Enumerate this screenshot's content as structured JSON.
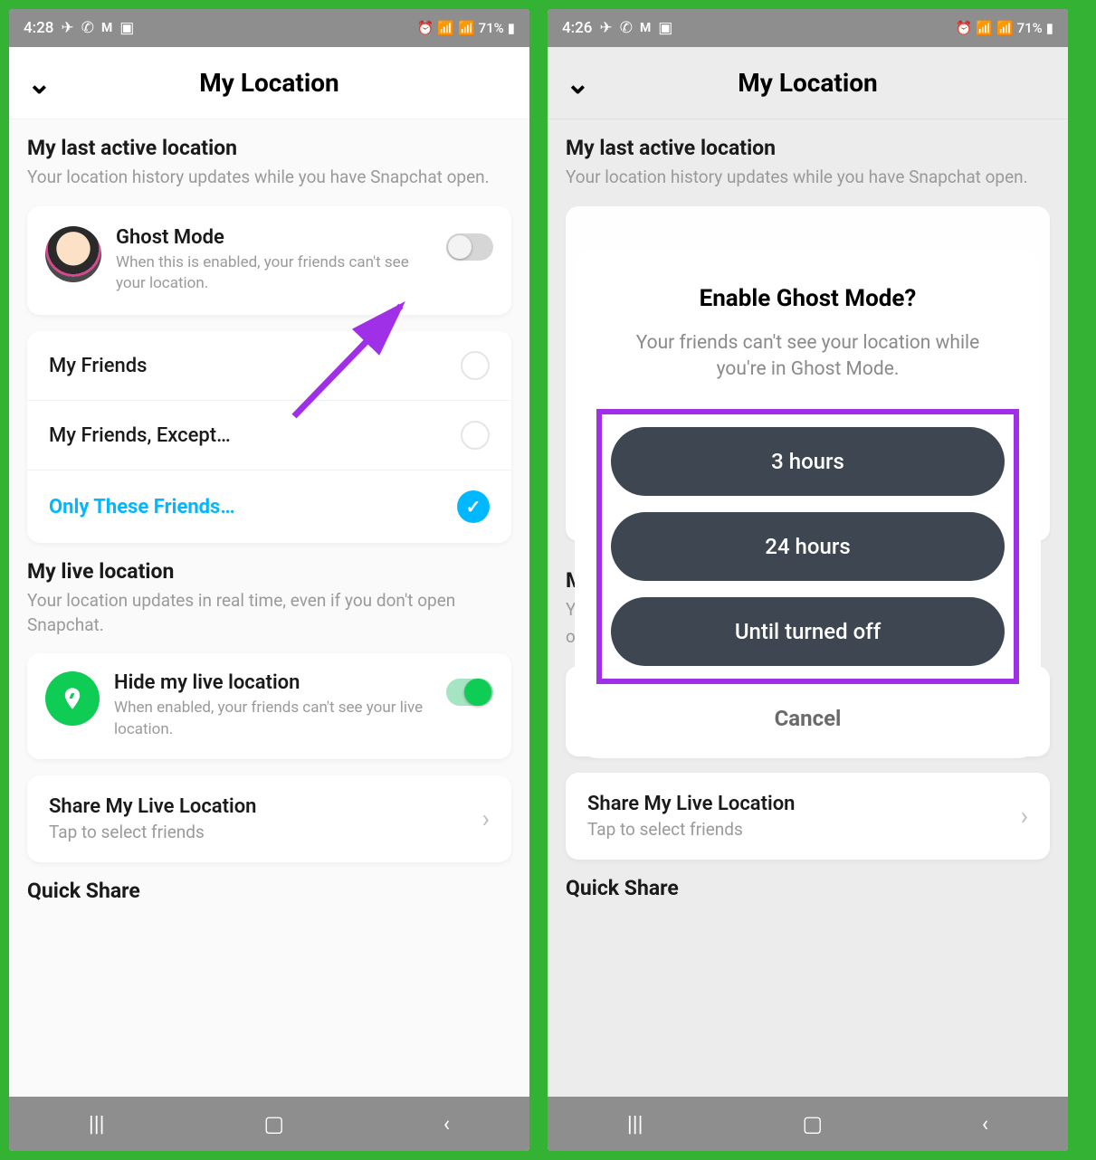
{
  "status": {
    "time_left": "4:28",
    "time_right": "4:26",
    "battery": "71%"
  },
  "header": {
    "title": "My Location"
  },
  "section1": {
    "title": "My last active location",
    "sub": "Your location history updates while you have Snapchat open."
  },
  "ghost": {
    "title": "Ghost Mode",
    "sub": "When this is enabled, your friends can't see your location."
  },
  "radios": {
    "opt1": "My Friends",
    "opt2": "My Friends, Except…",
    "opt3": "Only These Friends…"
  },
  "section2": {
    "title": "My live location",
    "sub": "Your location updates in real time, even if you don't open Snapchat."
  },
  "hide": {
    "title": "Hide my live location",
    "sub": "When enabled, your friends can't see your live location."
  },
  "share": {
    "title": "Share My Live Location",
    "sub": "Tap to select friends"
  },
  "cutoff": "Quick Share",
  "modal": {
    "title": "Enable Ghost Mode?",
    "sub": "Your friends can't see your location while you're in Ghost Mode.",
    "btn1": "3 hours",
    "btn2": "24 hours",
    "btn3": "Until turned off",
    "cancel": "Cancel"
  },
  "section2_truncated": {
    "initial1": "M",
    "initial2": "Y",
    "initial3": "o"
  }
}
